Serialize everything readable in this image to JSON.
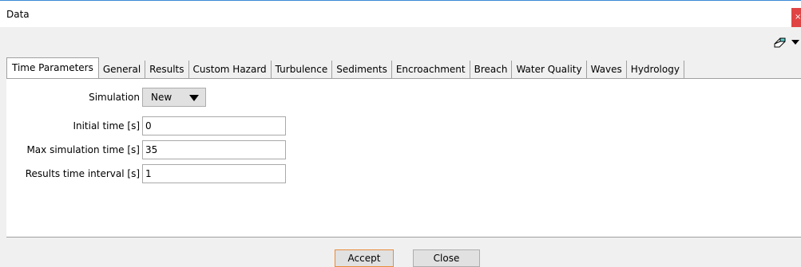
{
  "window": {
    "title": "Data",
    "close_icon": "close-icon",
    "close_glyph": "×"
  },
  "toolbar": {
    "eraser_icon": "eraser-icon",
    "dropdown_icon": "chevron-down-icon"
  },
  "tabs": [
    {
      "label": "Time Parameters",
      "active": true
    },
    {
      "label": "General",
      "active": false
    },
    {
      "label": "Results",
      "active": false
    },
    {
      "label": "Custom Hazard",
      "active": false
    },
    {
      "label": "Turbulence",
      "active": false
    },
    {
      "label": "Sediments",
      "active": false
    },
    {
      "label": "Encroachment",
      "active": false
    },
    {
      "label": "Breach",
      "active": false
    },
    {
      "label": "Water Quality",
      "active": false
    },
    {
      "label": "Waves",
      "active": false
    },
    {
      "label": "Hydrology",
      "active": false
    }
  ],
  "form": {
    "simulation": {
      "label": "Simulation",
      "value": "New"
    },
    "initial_time": {
      "label": "Initial time [s]",
      "value": "0"
    },
    "max_sim_time": {
      "label": "Max simulation time [s]",
      "value": "35"
    },
    "results_interval": {
      "label": "Results time interval [s]",
      "value": "1"
    }
  },
  "buttons": {
    "accept": "Accept",
    "close": "Close"
  },
  "colors": {
    "accent_border": "#e88b3a",
    "close_red": "#e04343",
    "title_line": "#3c8ad6"
  }
}
